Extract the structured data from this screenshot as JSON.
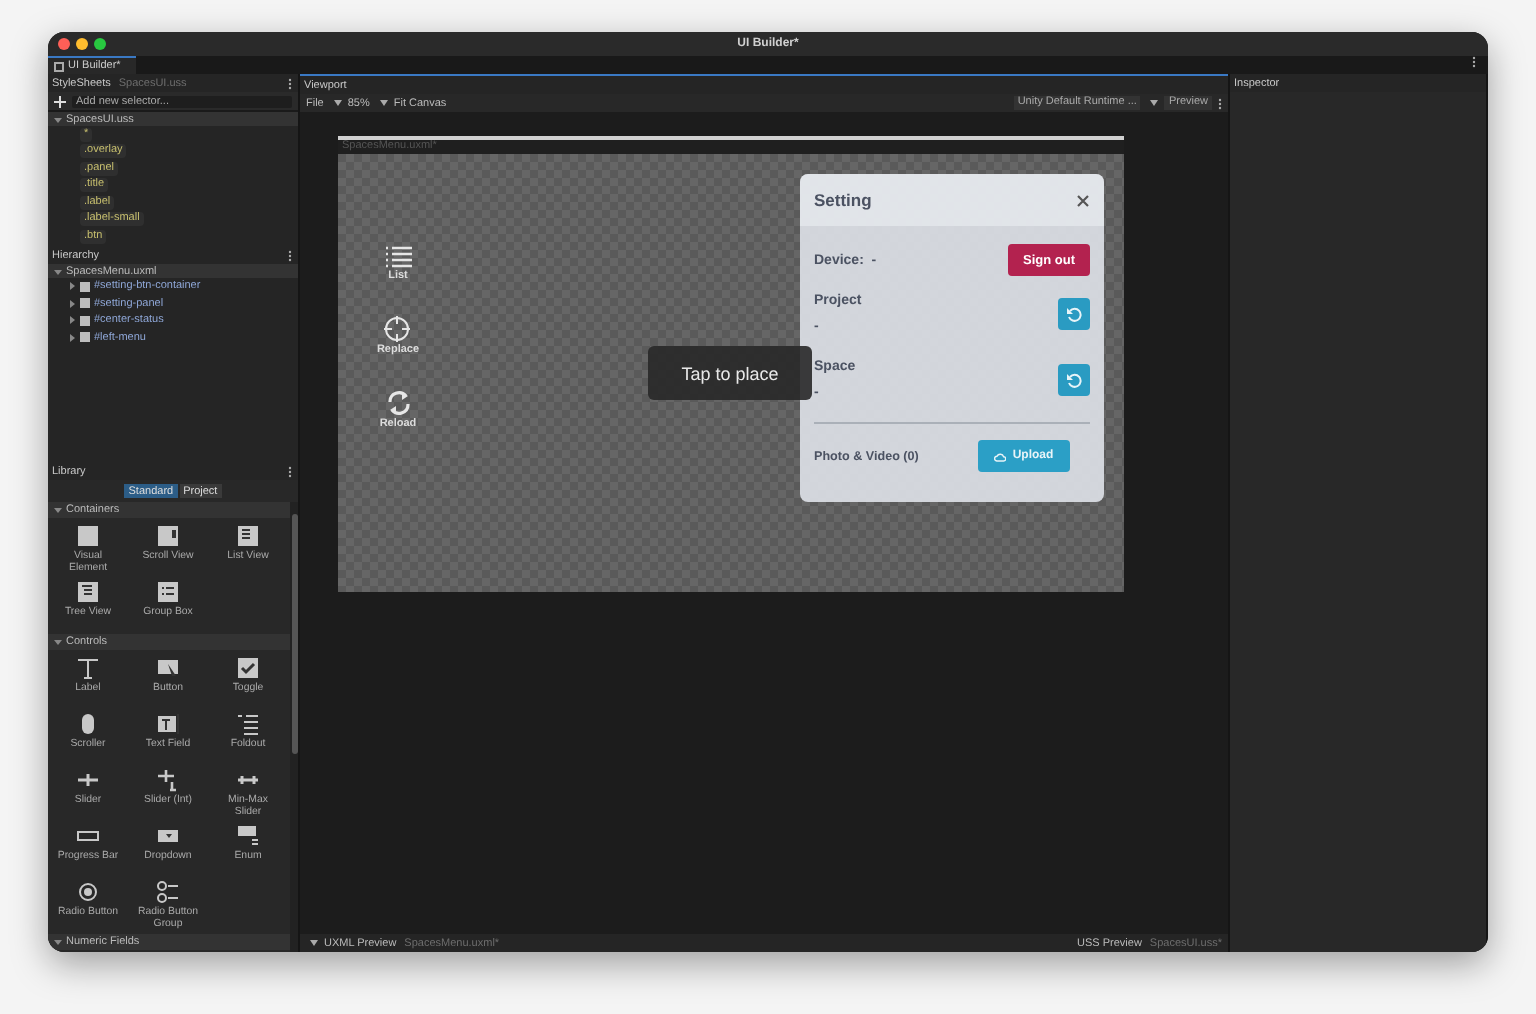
{
  "window": {
    "title": "UI Builder*"
  },
  "tab": {
    "label": "UI Builder*"
  },
  "stylesheets": {
    "title": "StyleSheets",
    "file": "SpacesUI.uss",
    "add_placeholder": "Add new selector...",
    "tree": {
      "label": "SpacesUI.uss",
      "children": [
        {
          "label": "*"
        },
        {
          "label": ".overlay"
        },
        {
          "label": ".panel"
        },
        {
          "label": ".title"
        },
        {
          "label": ".label"
        },
        {
          "label": ".label-small"
        },
        {
          "label": ".btn"
        }
      ]
    }
  },
  "hierarchy": {
    "title": "Hierarchy",
    "tree": {
      "label": "SpacesMenu.uxml",
      "children": [
        {
          "label": "#setting-btn-container"
        },
        {
          "label": "#setting-panel"
        },
        {
          "label": "#center-status"
        },
        {
          "label": "#left-menu"
        }
      ]
    }
  },
  "library": {
    "title": "Library",
    "tabs": [
      {
        "label": "Standard",
        "selected": true
      },
      {
        "label": "Project",
        "selected": false
      }
    ],
    "sections": [
      {
        "title": "Containers",
        "items": [
          {
            "kind": "box",
            "label": "Visual Element"
          },
          {
            "kind": "scroll",
            "label": "Scroll View"
          },
          {
            "kind": "list",
            "label": "List View"
          },
          {
            "kind": "tree",
            "label": "Tree View"
          },
          {
            "kind": "group",
            "label": "Group Box"
          }
        ]
      },
      {
        "title": "Controls",
        "items": [
          {
            "kind": "label",
            "label": "Label"
          },
          {
            "kind": "button",
            "label": "Button"
          },
          {
            "kind": "toggle",
            "label": "Toggle"
          },
          {
            "kind": "scroller",
            "label": "Scroller"
          },
          {
            "kind": "textfield",
            "label": "Text Field"
          },
          {
            "kind": "foldout",
            "label": "Foldout"
          },
          {
            "kind": "slider",
            "label": "Slider"
          },
          {
            "kind": "sliderint",
            "label": "Slider (Int)"
          },
          {
            "kind": "minmax",
            "label": "Min-Max Slider"
          },
          {
            "kind": "progress",
            "label": "Progress Bar"
          },
          {
            "kind": "dropdown",
            "label": "Dropdown"
          },
          {
            "kind": "enum",
            "label": "Enum"
          },
          {
            "kind": "radio",
            "label": "Radio Button"
          },
          {
            "kind": "radiogroup",
            "label": "Radio Button Group"
          }
        ]
      },
      {
        "title": "Numeric Fields"
      }
    ]
  },
  "viewport": {
    "title": "Viewport",
    "menu": "File",
    "zoom": "85%",
    "fit": "Fit Canvas",
    "theme": "Unity Default Runtime ...",
    "preview": "Preview",
    "document": "SpacesMenu.uxml*"
  },
  "canvas": {
    "side_buttons": [
      {
        "kind": "list",
        "label": "List"
      },
      {
        "kind": "replace",
        "label": "Replace"
      },
      {
        "kind": "reload",
        "label": "Reload"
      }
    ],
    "toast": "Tap to place",
    "panel": {
      "title": "Setting",
      "device_label": "Device:",
      "device_value": "-",
      "sign_out": "Sign out",
      "project_label": "Project",
      "project_value": "-",
      "space_label": "Space",
      "space_value": "-",
      "media_label": "Photo & Video (0)",
      "upload": "Upload"
    }
  },
  "bottom_bar": {
    "uxml_preview": "UXML Preview",
    "uxml_file": "SpacesMenu.uxml*",
    "uss_preview": "USS Preview",
    "uss_file": "SpacesUI.uss*"
  },
  "inspector": {
    "title": "Inspector"
  }
}
